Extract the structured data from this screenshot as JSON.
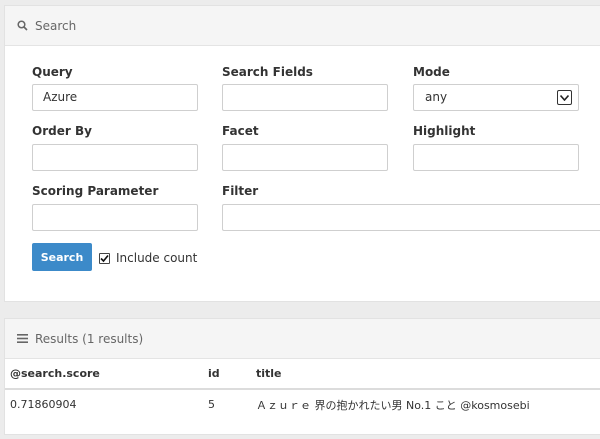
{
  "search_panel": {
    "title": "Search"
  },
  "query": {
    "label": "Query",
    "value": "Azure"
  },
  "search_fields": {
    "label": "Search Fields",
    "value": ""
  },
  "mode": {
    "label": "Mode",
    "value": "any"
  },
  "order_by": {
    "label": "Order By",
    "value": ""
  },
  "facet": {
    "label": "Facet",
    "value": ""
  },
  "highlight": {
    "label": "Highlight",
    "value": ""
  },
  "scoring": {
    "label": "Scoring Parameter",
    "value": ""
  },
  "filter": {
    "label": "Filter",
    "value": ""
  },
  "search_button": "Search",
  "include_count": {
    "label": "Include count",
    "checked": true
  },
  "results_panel": {
    "title": "Results (1 results)"
  },
  "results": {
    "headers": [
      "@search.score",
      "id",
      "title"
    ],
    "rows": [
      [
        "0.71860904",
        "5",
        "Ａｚｕｒｅ 界の抱かれたい男 No.1 こと @kosmosebi"
      ]
    ]
  }
}
